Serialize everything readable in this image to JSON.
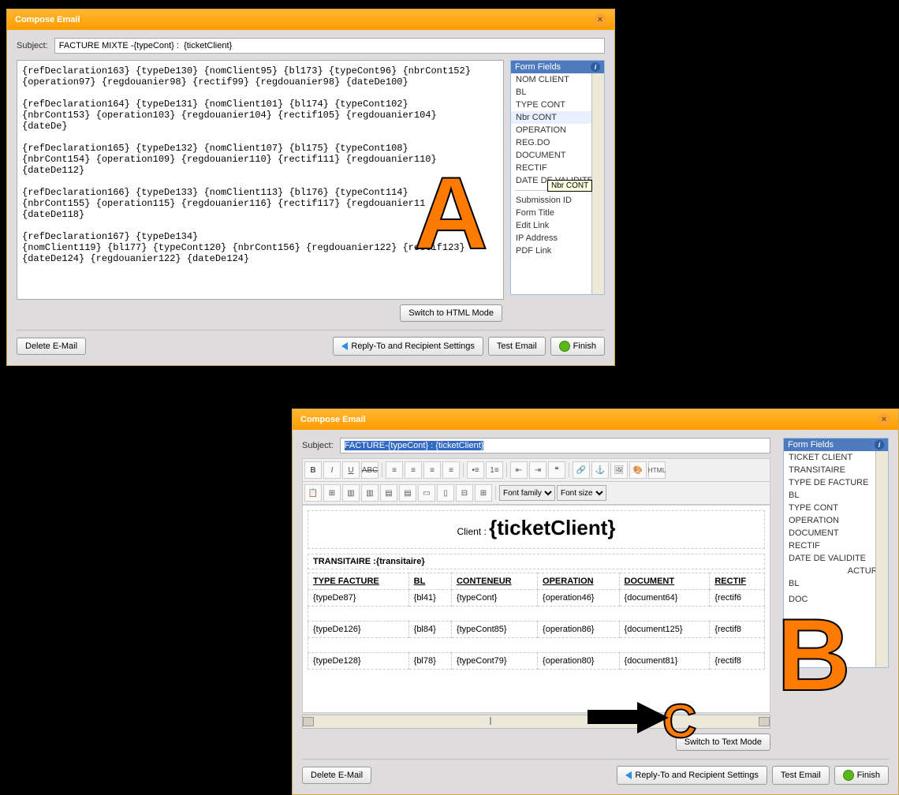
{
  "windowA": {
    "title": "Compose Email",
    "subject_label": "Subject:",
    "subject_value": "FACTURE MIXTE -{typeCont} :  {ticketClient}",
    "body_text": "{refDeclaration163} {typeDe130} {nomClient95} {bl173} {typeCont96} {nbrCont152}\n{operation97} {regdouanier98} {rectif99} {regdouanier98} {dateDe100}\n\n{refDeclaration164} {typeDe131} {nomClient101} {bl174} {typeCont102}\n{nbrCont153} {operation103} {regdouanier104} {rectif105} {regdouanier104}\n{dateDe}\n\n{refDeclaration165} {typeDe132} {nomClient107} {bl175} {typeCont108}\n{nbrCont154} {operation109} {regdouanier110} {rectif111} {regdouanier110}\n{dateDe112}\n\n{refDeclaration166} {typeDe133} {nomClient113} {bl176} {typeCont114}\n{nbrCont155} {operation115} {regdouanier116} {rectif117} {regdouanier11\n{dateDe118}\n\n{refDeclaration167} {typeDe134}\n{nomClient119} {bl177} {typeCont120} {nbrCont156} {regdouanier122} {rectif123}\n{dateDe124} {regdouanier122} {dateDe124}",
    "switch_label": "Switch to HTML Mode",
    "tooltip": "Nbr CONT",
    "sidebar": {
      "header": "Form Fields",
      "items": [
        "NOM CLIENT",
        "BL",
        "TYPE CONT",
        "Nbr CONT",
        "OPERATION",
        "REG.DO",
        "DOCUMENT",
        "RECTIF",
        "DATE DE VALIDITE"
      ],
      "extra": [
        "Submission ID",
        "Form Title",
        "Edit Link",
        "IP Address",
        "PDF Link"
      ]
    }
  },
  "windowB": {
    "title": "Compose Email",
    "subject_label": "Subject:",
    "subject_value": "FACTURE-{typeCont} :  {ticketClient}",
    "toolbar": {
      "font_family_label": "Font family",
      "font_size_label": "Font size"
    },
    "client_prefix": "Client :",
    "client_value": "{ticketClient}",
    "trans_label": "TRANSITAIRE :",
    "trans_value": "{transitaire}",
    "table": {
      "headers": [
        "TYPE FACTURE",
        "BL",
        "CONTENEUR",
        "OPERATION",
        "DOCUMENT",
        "RECTIF"
      ],
      "rows": [
        [
          "{typeDe87}",
          "{bl41}",
          "{typeCont}",
          "{operation46}",
          "{document64}",
          "{rectif6"
        ],
        [
          "{typeDe126}",
          "{bl84}",
          "{typeCont85}",
          "{operation86}",
          "{document125}",
          "{rectif8"
        ],
        [
          "{typeDe128}",
          "{bl78}",
          "{typeCont79}",
          "{operation80}",
          "{document81}",
          "{rectif8"
        ]
      ]
    },
    "sidebar": {
      "header": "Form Fields",
      "items": [
        "TICKET CLIENT",
        "TRANSITAIRE",
        "TYPE DE FACTURE",
        "BL",
        "TYPE CONT",
        "OPERATION",
        "DOCUMENT",
        "RECTIF",
        "DATE DE VALIDITE",
        "            ACTURE",
        "BL",
        "",
        "DOC"
      ]
    },
    "switch_label": "Switch to Text Mode"
  },
  "footer": {
    "delete": "Delete E-Mail",
    "reply": "Reply-To and Recipient Settings",
    "test": "Test Email",
    "finish": "Finish"
  },
  "callouts": {
    "A": "A",
    "B": "B",
    "C": "C"
  }
}
